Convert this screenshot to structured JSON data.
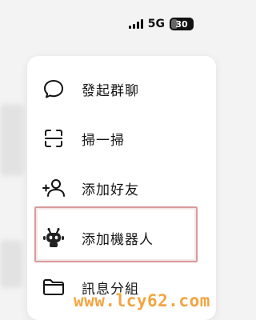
{
  "status_bar": {
    "network": "5G",
    "battery": "30",
    "battery_level": 0.3
  },
  "menu": {
    "items": [
      {
        "label": "發起群聊",
        "icon": "chat-bubble-icon"
      },
      {
        "label": "掃一掃",
        "icon": "scan-icon"
      },
      {
        "label": "添加好友",
        "icon": "add-friend-icon"
      },
      {
        "label": "添加機器人",
        "icon": "robot-icon"
      },
      {
        "label": "訊息分組",
        "icon": "folder-icon"
      }
    ]
  },
  "watermark": "www.lcy62.com"
}
